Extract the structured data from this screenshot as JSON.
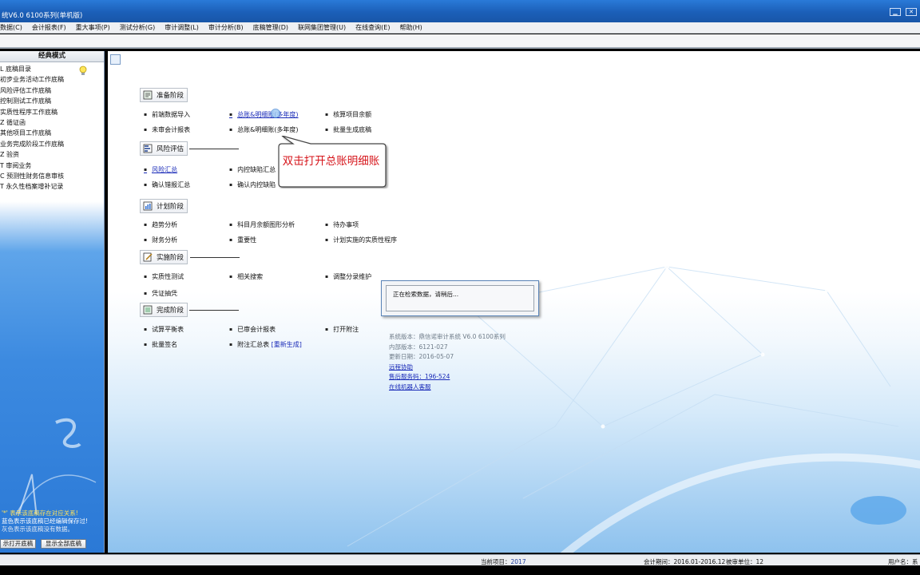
{
  "window": {
    "title": "统V6.0 6100系列(单机版)"
  },
  "menu": [
    "数据(C)",
    "会计报表(F)",
    "重大事项(P)",
    "测试分析(G)",
    "审计调整(L)",
    "审计分析(B)",
    "底稿管理(D)",
    "联网集团管理(U)",
    "在线查询(E)",
    "帮助(H)"
  ],
  "sidebar": {
    "header": "经典模式",
    "tree": [
      "L 底稿目录",
      "  初步业务活动工作底稿",
      "  风险评估工作底稿",
      "  控制测试工作底稿",
      "实质性程序工作底稿",
      "Z 循证函",
      "  其他项目工作底稿",
      "  业务完成阶段工作底稿",
      "Z 验资",
      "T 审阅业务",
      "C 预测性财务信息审核",
      "T 永久性档案增补记录"
    ],
    "legend": [
      "'*' 表示该底稿存在对应关系!",
      "蓝色表示该底稿已经编辑保存过!",
      "灰色表示该底稿没有数据。"
    ],
    "btn_open": "示打开底稿",
    "btn_all": "显示全部底稿"
  },
  "stages": {
    "prepare": {
      "label": "准备阶段",
      "r1": [
        "前端数据导入",
        "总账&明细账(多年度)",
        "核算项目余额"
      ],
      "r2": [
        "未审会计报表",
        "总账&明细账(多年度)",
        "批量生成底稿"
      ]
    },
    "risk": {
      "label": "风险评估",
      "r1": [
        "风险汇总",
        "内控缺陷汇总"
      ],
      "r2": [
        "确认错报汇总",
        "确认内控缺陷"
      ]
    },
    "plan": {
      "label": "计划阶段",
      "r1": [
        "趋势分析",
        "科目月余额图形分析",
        "待办事项"
      ],
      "r2": [
        "财务分析",
        "重要性",
        "计划实施的实质性程序"
      ]
    },
    "implement": {
      "label": "实施阶段",
      "r1": [
        "实质性测试",
        "相关搜索",
        "调整分录维护"
      ],
      "r2": [
        "凭证抽凭"
      ]
    },
    "complete": {
      "label": "完成阶段",
      "r1": [
        "试算平衡表",
        "已审会计报表",
        "打开附注"
      ],
      "r2": [
        "批量签名",
        "附注汇总表",
        "[重新生成]"
      ]
    }
  },
  "callout": "双击打开总账明细账",
  "loading": "正在检索数据，请稍后...",
  "sysinfo": {
    "version": "系统版本：鼎信诺审计系统 V6.0 6100系列",
    "internal": "内部版本：6121-027",
    "updated": "更新日期：2016-05-07",
    "remote": "远程协助",
    "service": "售后服务码：196-524",
    "robot": "在线机器人客服"
  },
  "status": {
    "project_label": "当前项目：",
    "project": "2017",
    "period_label": "会计期间：",
    "period": "2016.01-2016.12",
    "unit_label": "被审单位：",
    "unit": "12",
    "user_label": "用户名：",
    "user": "系"
  },
  "colors": {
    "title_bar": "#1b5fb8",
    "link_blue": "#1a2bb8",
    "callout_red": "#d6151b"
  },
  "icons": [
    "lightbulb-icon",
    "refresh-icon",
    "prepare-stage-icon",
    "risk-stage-icon",
    "plan-chart-icon",
    "implement-stage-icon",
    "complete-stage-icon"
  ]
}
